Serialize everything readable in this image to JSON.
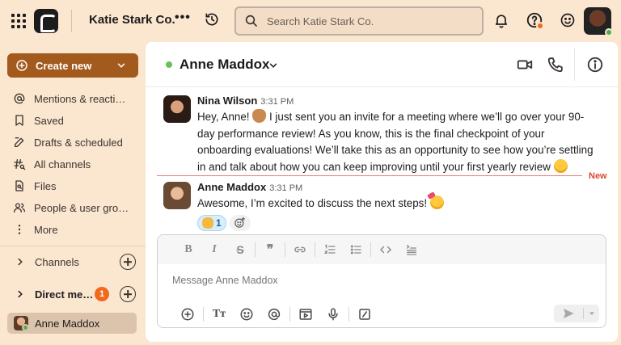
{
  "topbar": {
    "workspace_name": "Katie Stark Co.",
    "more_label": "•••",
    "search_placeholder": "Search Katie Stark Co."
  },
  "sidebar": {
    "create_label": "Create new",
    "items": [
      {
        "label": "Mentions & reacti…",
        "icon": "at-icon"
      },
      {
        "label": "Saved",
        "icon": "bookmark-icon"
      },
      {
        "label": "Drafts & scheduled",
        "icon": "pencil-icon"
      },
      {
        "label": "All channels",
        "icon": "hash-search-icon"
      },
      {
        "label": "Files",
        "icon": "file-search-icon"
      },
      {
        "label": "People & user gro…",
        "icon": "people-icon"
      },
      {
        "label": "More",
        "icon": "more-dots-icon"
      }
    ],
    "channels_label": "Channels",
    "direct_messages_label": "Direct me…",
    "direct_messages_badge": "1",
    "active_dm": "Anne Maddox"
  },
  "channel": {
    "name": "Anne Maddox",
    "status_color": "#6cbf5a"
  },
  "messages": [
    {
      "author": "Nina Wilson",
      "time": "3:31 PM",
      "text_before": "Hey, Anne! ",
      "text_after": " I just sent you an invite for a meeting where we’ll go over your 90-day performance review! As you know, this is the final checkpoint of your onboarding evaluations! We’ll take this as an opportunity to see how you’re settling in and talk about how you can keep improving until your first yearly review ",
      "emoji_1": "wave-emoji",
      "emoji_2": "smile-emoji"
    },
    {
      "author": "Anne Maddox",
      "time": "3:31 PM",
      "text": "Awesome, I’m excited to discuss the next steps! ",
      "emoji": "party-face-emoji",
      "reaction_emoji": "raised-hands-emoji",
      "reaction_count": "1"
    }
  ],
  "divider": {
    "label": "New"
  },
  "composer": {
    "placeholder": "Message Anne Maddox",
    "text_format_label": "Tт"
  },
  "colors": {
    "background": "#fbe6cf",
    "brand_button": "#a35a1d",
    "badge": "#f06a1e",
    "new_divider": "#e87c6c"
  }
}
